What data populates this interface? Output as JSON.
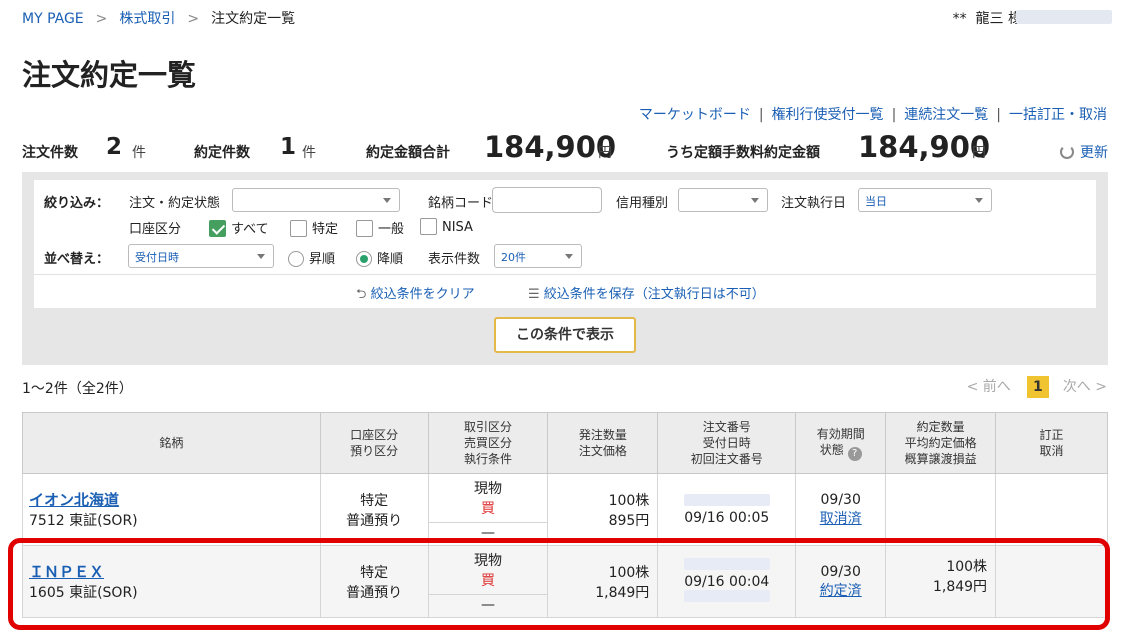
{
  "breadcrumb": {
    "home": "MY PAGE",
    "sep1": ">",
    "section": "株式取引",
    "sep2": ">",
    "current": "注文約定一覧"
  },
  "user": {
    "stars": "**",
    "name": "龍三 様"
  },
  "title": "注文約定一覧",
  "links": {
    "market": "マーケットボード",
    "rights": "権利行使受付一覧",
    "chain": "連続注文一覧",
    "bulk": "一括訂正・取消",
    "bar": "|"
  },
  "summary": {
    "orders_label": "注文件数",
    "orders_value": "2",
    "orders_unit": "件",
    "exec_label": "約定件数",
    "exec_value": "1",
    "exec_unit": "件",
    "amount_label": "約定金額合計",
    "amount_value": "184,900",
    "amount_unit": "円",
    "fee_label": "うち定額手数料約定金額",
    "fee_value": "184,900",
    "fee_unit": "円",
    "refresh": "更新"
  },
  "filter": {
    "narrow_label": "絞り込み：",
    "status_label": "注文・約定状態",
    "code_label": "銘柄コード",
    "credit_label": "信用種別",
    "exec_date_label": "注文執行日",
    "exec_date_value": "当日",
    "account_label": "口座区分",
    "opt_all": "すべて",
    "opt_tokutei": "特定",
    "opt_ippan": "一般",
    "opt_nisa": "NISA",
    "sort_label": "並べ替え：",
    "sort_value": "受付日時",
    "asc": "昇順",
    "desc": "降順",
    "count_label": "表示件数",
    "count_value": "20件",
    "clear": "絞込条件をクリア",
    "save": "絞込条件を保存（注文執行日は不可）",
    "show": "この条件で表示"
  },
  "paging": {
    "info": "1〜2件（全2件）",
    "prev": "< 前へ",
    "page": "1",
    "next": "次へ >"
  },
  "table": {
    "headers": {
      "stock": "銘柄",
      "account1": "口座区分",
      "account2": "預り区分",
      "trade1": "取引区分",
      "trade2": "売買区分",
      "trade3": "執行条件",
      "qty1": "発注数量",
      "qty2": "注文価格",
      "order1": "注文番号",
      "order2": "受付日時",
      "order3": "初回注文番号",
      "valid1": "有効期間",
      "valid2": "状態",
      "exec1": "約定数量",
      "exec2": "平均約定価格",
      "exec3": "概算譲渡損益",
      "mod1": "訂正",
      "mod2": "取消"
    },
    "rows": [
      {
        "name": "イオン北海道",
        "code": "7512 東証(SOR)",
        "account": "特定",
        "deposit": "普通預り",
        "trade": "現物",
        "side": "買",
        "cond": "—",
        "qty": "100株",
        "price": "895円",
        "time": "09/16 00:05",
        "valid": "09/30",
        "status": "取消済",
        "exec_qty": "",
        "exec_price": ""
      },
      {
        "name": "ＩＮＰＥＸ",
        "code": "1605 東証(SOR)",
        "account": "特定",
        "deposit": "普通預り",
        "trade": "現物",
        "side": "買",
        "cond": "—",
        "qty": "100株",
        "price": "1,849円",
        "time": "09/16 00:04",
        "valid": "09/30",
        "status": "約定済",
        "exec_qty": "100株",
        "exec_price": "1,849円"
      }
    ]
  },
  "colors": {
    "link": "#1a5fb4",
    "buy": "#dd3333",
    "highlight": "#e00000",
    "button_border": "#e5b84a"
  }
}
